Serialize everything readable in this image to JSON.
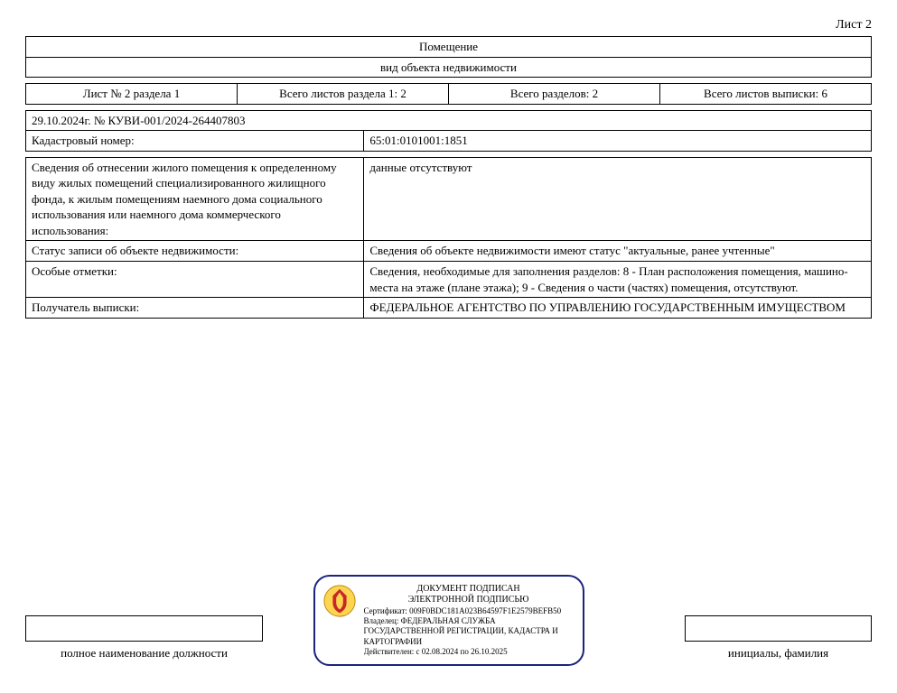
{
  "page_number": "Лист 2",
  "header": {
    "title": "Помещение",
    "subtitle": "вид объекта недвижимости"
  },
  "section_row": {
    "c1": "Лист № 2 раздела 1",
    "c2": "Всего листов раздела 1: 2",
    "c3": "Всего разделов: 2",
    "c4": "Всего листов выписки: 6"
  },
  "meta": {
    "doc_ref": "29.10.2024г. № КУВИ-001/2024-264407803",
    "cad_label": "Кадастровый номер:",
    "cad_value": "65:01:0101001:1851"
  },
  "rows": [
    {
      "label": "Сведения об отнесении жилого помещения к определенному виду жилых помещений специализированного жилищного фонда, к жилым помещениям наемного дома социального использования или наемного дома коммерческого использования:",
      "value": "данные отсутствуют"
    },
    {
      "label": "Статус записи об объекте недвижимости:",
      "value": "Сведения об объекте недвижимости имеют статус \"актуальные, ранее учтенные\""
    },
    {
      "label": "Особые отметки:",
      "value": "Сведения, необходимые для заполнения разделов: 8 - План расположения помещения, машино-места на этаже (плане этажа); 9 - Сведения о части (частях) помещения, отсутствуют."
    },
    {
      "label": "Получатель выписки:",
      "value": "ФЕДЕРАЛЬНОЕ АГЕНТСТВО ПО УПРАВЛЕНИЮ ГОСУДАРСТВЕННЫМ ИМУЩЕСТВОМ"
    }
  ],
  "footer": {
    "position_label": "полное наименование должности",
    "initials_label": "инициалы, фамилия"
  },
  "signature": {
    "line1": "ДОКУМЕНТ ПОДПИСАН",
    "line2": "ЭЛЕКТРОННОЙ ПОДПИСЬЮ",
    "cert_label": "Сертификат:",
    "cert_value": "009F0BDC181A023B64597F1E2579BEFB50",
    "owner_label": "Владелец:",
    "owner_value": "ФЕДЕРАЛЬНАЯ СЛУЖБА ГОСУДАРСТВЕННОЙ РЕГИСТРАЦИИ, КАДАСТРА И КАРТОГРАФИИ",
    "valid_label": "Действителен:",
    "valid_value": "с 02.08.2024 по 26.10.2025"
  }
}
